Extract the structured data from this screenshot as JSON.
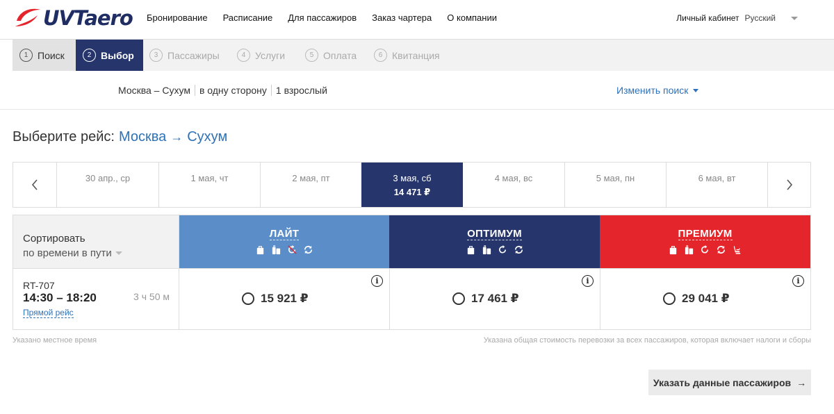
{
  "brand": {
    "logo_text": "UVTaero",
    "accent": "#e4262c",
    "navy": "#26356b"
  },
  "nav": [
    "Бронирование",
    "Расписание",
    "Для пассажиров",
    "Заказ чартера",
    "О компании"
  ],
  "header_right": {
    "cabinet": "Личный кабинет",
    "language": "Русский"
  },
  "steps": [
    {
      "num": "1",
      "label": "Поиск",
      "state": "done"
    },
    {
      "num": "2",
      "label": "Выбор",
      "state": "active"
    },
    {
      "num": "3",
      "label": "Пассажиры",
      "state": "disabled"
    },
    {
      "num": "4",
      "label": "Услуги",
      "state": "disabled"
    },
    {
      "num": "5",
      "label": "Оплата",
      "state": "disabled"
    },
    {
      "num": "6",
      "label": "Квитанция",
      "state": "disabled"
    }
  ],
  "route": {
    "cities": "Москва – Сухум",
    "trip_type": "в одну сторону",
    "passengers": "1 взрослый",
    "change_search": "Изменить поиск"
  },
  "title": {
    "prefix": "Выберите рейс:",
    "from": "Москва",
    "arrow": "→",
    "to": "Сухум"
  },
  "dates": [
    {
      "label": "30 апр., ср",
      "price": ""
    },
    {
      "label": "1 мая, чт",
      "price": ""
    },
    {
      "label": "2 мая, пт",
      "price": ""
    },
    {
      "label": "3 мая, сб",
      "price": "14 471 ₽",
      "active": true
    },
    {
      "label": "4 мая, вс",
      "price": ""
    },
    {
      "label": "5 мая, пн",
      "price": ""
    },
    {
      "label": "6 мая, вт",
      "price": ""
    }
  ],
  "sort": {
    "label": "Сортировать",
    "by": "по времени в пути"
  },
  "tariffs": [
    {
      "name": "ЛАЙТ",
      "color": "#5b8dc9",
      "icons": [
        "bag-icon",
        "luggage-icon",
        "no-return-icon",
        "exchange-icon"
      ]
    },
    {
      "name": "ОПТИМУМ",
      "color": "#26356b",
      "icons": [
        "bag-icon",
        "luggage-icon",
        "return-icon",
        "exchange-icon"
      ]
    },
    {
      "name": "ПРЕМИУМ",
      "color": "#e4262c",
      "icons": [
        "bag-icon",
        "luggage-icon",
        "return-icon",
        "exchange-icon",
        "seat-icon"
      ]
    }
  ],
  "flight": {
    "number": "RT-707",
    "times": "14:30 – 18:20",
    "duration": "3 ч 50 м",
    "type": "Прямой рейс",
    "prices": [
      "15 921 ₽",
      "17 461 ₽",
      "29 041 ₽"
    ]
  },
  "notes": {
    "local_time": "Указано местное время",
    "total_cost": "Указана общая стоимость перевозки за всех пассажиров, которая включает налоги и сборы"
  },
  "next_button": {
    "label": "Указать данные пассажиров",
    "arrow": "→"
  }
}
